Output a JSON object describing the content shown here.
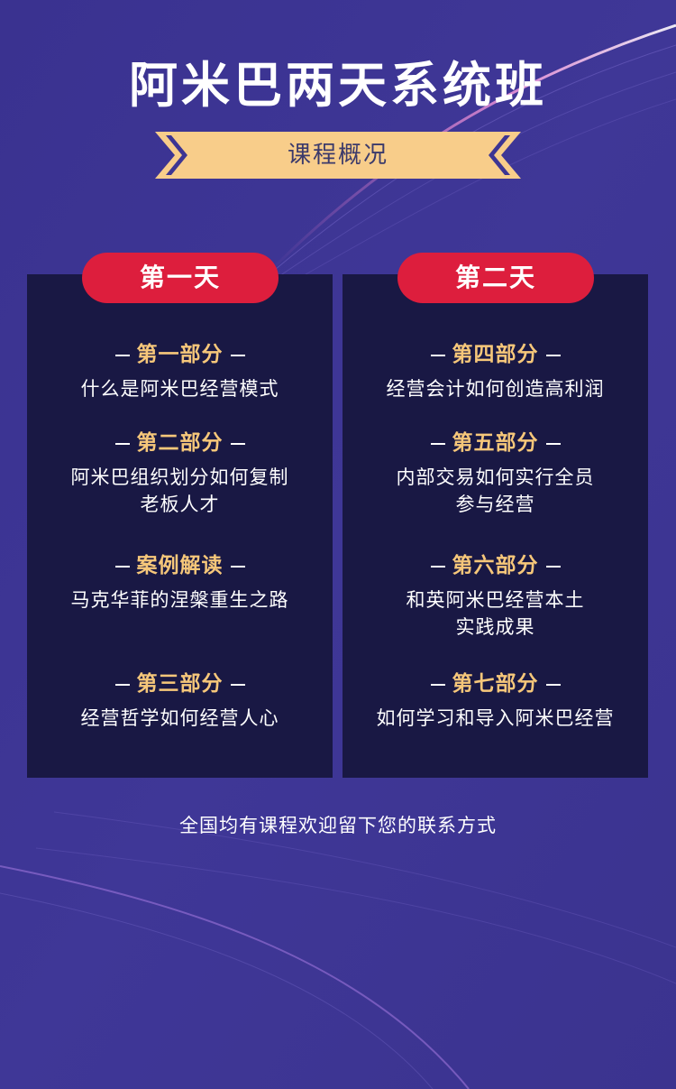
{
  "title": "阿米巴两天系统班",
  "subtitle": "课程概况",
  "colors": {
    "background": "#3d3593",
    "panel": "#191844",
    "day_pill": "#dd1e3d",
    "section_heading": "#f6c77a",
    "ribbon": "#f8cd8a"
  },
  "days": [
    {
      "label": "第一天",
      "sections": [
        {
          "heading": "第一部分",
          "lines": [
            "什么是阿米巴经营模式"
          ]
        },
        {
          "heading": "第二部分",
          "lines": [
            "阿米巴组织划分如何复制",
            "老板人才"
          ]
        },
        {
          "heading": "案例解读",
          "lines": [
            "马克华菲的涅槃重生之路"
          ]
        },
        {
          "heading": "第三部分",
          "lines": [
            "经营哲学如何经营人心"
          ]
        }
      ]
    },
    {
      "label": "第二天",
      "sections": [
        {
          "heading": "第四部分",
          "lines": [
            "经营会计如何创造高利润"
          ]
        },
        {
          "heading": "第五部分",
          "lines": [
            "内部交易如何实行全员",
            "参与经营"
          ]
        },
        {
          "heading": "第六部分",
          "lines": [
            "和英阿米巴经营本土",
            "实践成果"
          ]
        },
        {
          "heading": "第七部分",
          "lines": [
            "如何学习和导入阿米巴经营"
          ]
        }
      ]
    }
  ],
  "footer": "全国均有课程欢迎留下您的联系方式"
}
